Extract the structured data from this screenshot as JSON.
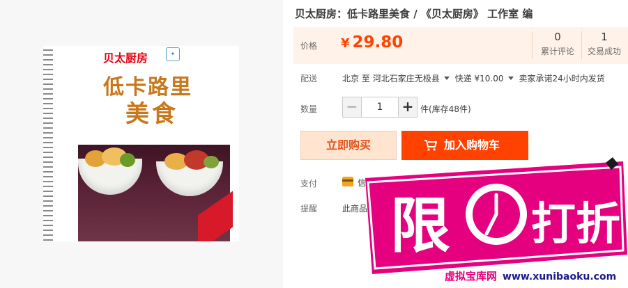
{
  "product": {
    "title": "贝太厨房：低卡路里美食 / 《贝太厨房》 工作室 编"
  },
  "cover": {
    "brand": "贝太厨房",
    "title_line1": "低卡路里",
    "title_line2": "美食"
  },
  "price": {
    "label": "价格",
    "currency": "¥",
    "value": "29.80",
    "reviews_count": "0",
    "reviews_label": "累计评论",
    "sales_count": "1",
    "sales_label": "交易成功"
  },
  "shipping": {
    "label": "配送",
    "from": "北京",
    "to_word": "至",
    "destination": "河北石家庄无极县",
    "method": "快递 ¥10.00",
    "promise": "卖家承诺24小时内发货"
  },
  "quantity": {
    "label": "数量",
    "minus": "−",
    "value": "1",
    "plus": "+",
    "unit_stock": "件(库存48件)"
  },
  "actions": {
    "buy_now": "立即购买",
    "add_to_cart": "加入购物车"
  },
  "payment": {
    "label": "支付",
    "credit_card": "信用卡支付"
  },
  "notice": {
    "label": "提醒",
    "text": "此商品"
  },
  "promo": {
    "text": "限时打折"
  },
  "watermark": {
    "site": "虚拟宝库网",
    "url": "www.xunibaoku.com"
  },
  "colors": {
    "price": "#ff4400",
    "cart_button": "#ff4200",
    "promo_magenta": "#e4007f"
  }
}
